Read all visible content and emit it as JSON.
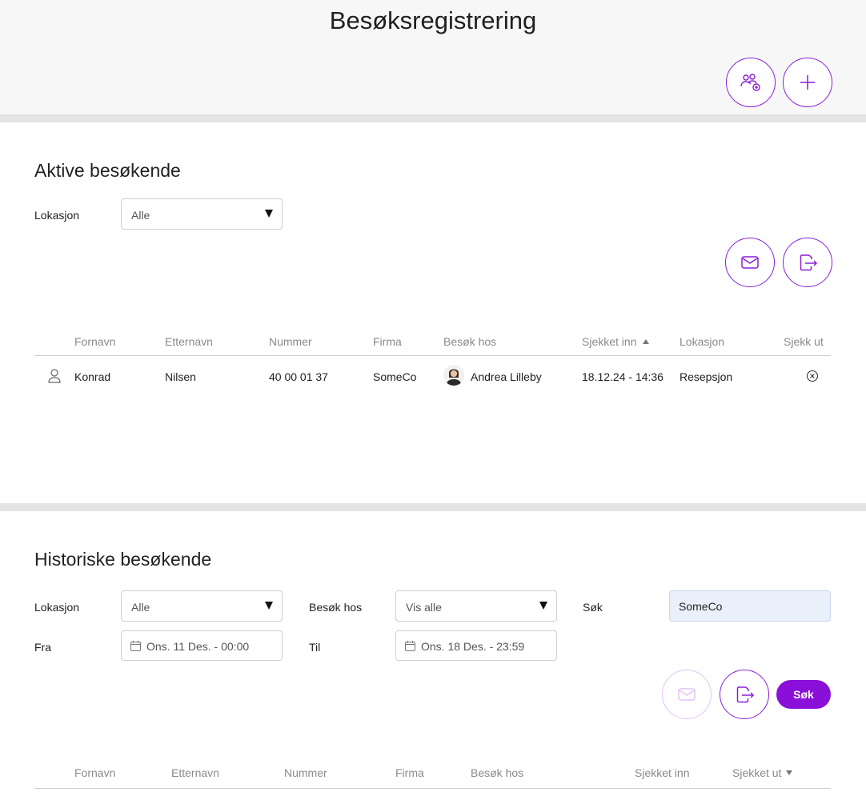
{
  "header": {
    "title": "Besøksregistrering",
    "buttons": [
      {
        "icon": "group-add-icon"
      },
      {
        "icon": "plus-icon"
      }
    ]
  },
  "active": {
    "title": "Aktive besøkende",
    "location_label": "Lokasjon",
    "location_value": "Alle",
    "action_icons": [
      "mail-icon",
      "export-icon"
    ],
    "columns": [
      "Fornavn",
      "Etternavn",
      "Nummer",
      "Firma",
      "Besøk hos",
      "Sjekket inn",
      "Lokasjon",
      "Sjekk ut"
    ],
    "sorted_column": "Sjekket inn",
    "sort_direction": "ascending",
    "rows": [
      {
        "fornavn": "Konrad",
        "etternavn": "Nilsen",
        "nummer": "40 00 01 37",
        "firma": "SomeCo",
        "besok_hos": "Andrea Lilleby",
        "sjekket_inn": "18.12.24 - 14:36",
        "lokasjon": "Resepsjon"
      }
    ]
  },
  "history": {
    "title": "Historiske besøkende",
    "location_label": "Lokasjon",
    "location_value": "Alle",
    "visit_label": "Besøk hos",
    "visit_value": "Vis alle",
    "search_label": "Søk",
    "search_value": "SomeCo",
    "from_label": "Fra",
    "from_value": "Ons. 11 Des. - 00:00",
    "to_label": "Til",
    "to_value": "Ons. 18 Des. - 23:59",
    "search_button": "Søk",
    "columns": [
      "Fornavn",
      "Etternavn",
      "Nummer",
      "Firma",
      "Besøk hos",
      "Sjekket inn",
      "Sjekket ut"
    ],
    "sorted_column": "Sjekket ut",
    "sort_direction": "descending"
  },
  "colors": {
    "accent": "#8a0fd8",
    "accent_faded": "#e4c3f6",
    "search_bg": "#e9f0fb"
  }
}
